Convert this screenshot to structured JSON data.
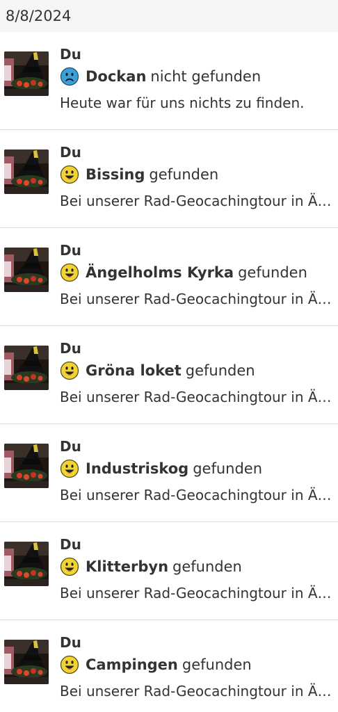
{
  "date_header": "8/8/2024",
  "colors": {
    "found_icon": "#f2d335",
    "dnf_icon": "#3aa0d8",
    "text": "#333333",
    "divider": "#dddddd",
    "header_bg": "#f5f5f5"
  },
  "logs": [
    {
      "author": "Du",
      "icon": "sad-face-icon",
      "cache_name": "Dockan",
      "status": "nicht gefunden",
      "text": "Heute war für uns nichts zu finden."
    },
    {
      "author": "Du",
      "icon": "smiley-icon",
      "cache_name": "Bissing",
      "status": "gefunden",
      "text": "Bei unserer Rad-Geocachingtour in Ängelholm"
    },
    {
      "author": "Du",
      "icon": "smiley-icon",
      "cache_name": "Ängelholms Kyrka",
      "status": "gefunden",
      "text": "Bei unserer Rad-Geocachingtour in Ängelholm"
    },
    {
      "author": "Du",
      "icon": "smiley-icon",
      "cache_name": "Gröna loket",
      "status": "gefunden",
      "text": "Bei unserer Rad-Geocachingtour in Ängelholm"
    },
    {
      "author": "Du",
      "icon": "smiley-icon",
      "cache_name": "Industriskog",
      "status": "gefunden",
      "text": "Bei unserer Rad-Geocachingtour in Ängelholm"
    },
    {
      "author": "Du",
      "icon": "smiley-icon",
      "cache_name": "Klitterbyn",
      "status": "gefunden",
      "text": "Bei unserer Rad-Geocachingtour in Ängelholm"
    },
    {
      "author": "Du",
      "icon": "smiley-icon",
      "cache_name": "Campingen",
      "status": "gefunden",
      "text": "Bei unserer Rad-Geocachingtour in Ängelholm"
    }
  ]
}
